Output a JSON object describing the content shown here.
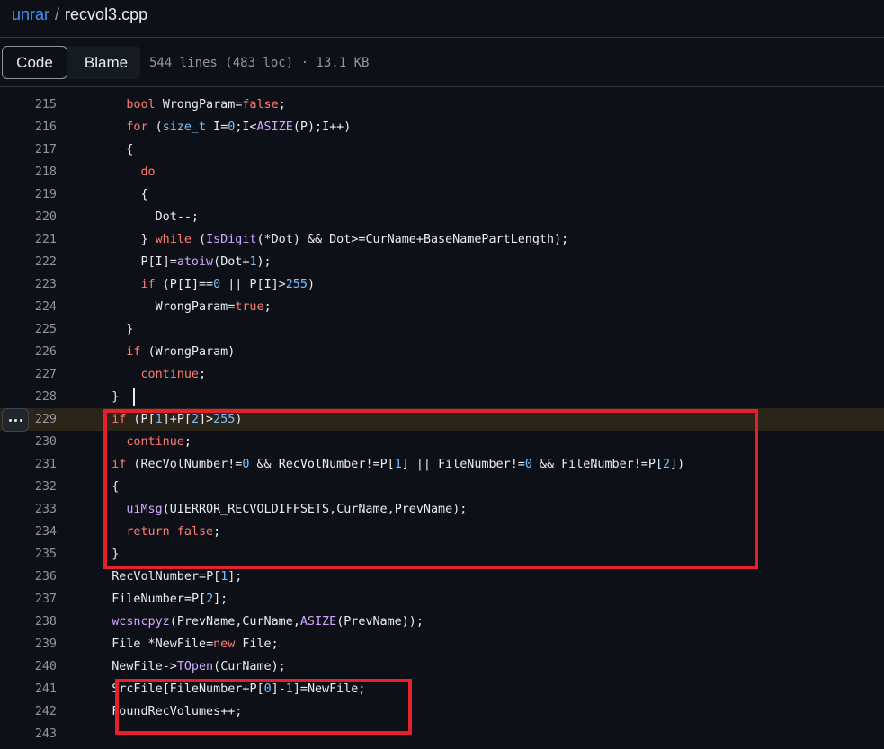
{
  "breadcrumb": {
    "repo": "unrar",
    "separator": "/",
    "file": "recvol3.cpp"
  },
  "toolbar": {
    "code_label": "Code",
    "blame_label": "Blame",
    "meta": "544 lines (483 loc) · 13.1 KB"
  },
  "colors": {
    "background": "#0d1117",
    "keyword": "#ff7b72",
    "function": "#d2a8ff",
    "constant": "#79c0ff",
    "annotation_box": "#e5202d",
    "highlight_line": "#2b2419"
  },
  "icons": {
    "more_button": "kebab-horizontal-icon"
  },
  "lines": [
    {
      "n": "215",
      "text": "      bool WrongParam=false;"
    },
    {
      "n": "216",
      "text": "      for (size_t I=0;I<ASIZE(P);I++)"
    },
    {
      "n": "217",
      "text": "      {"
    },
    {
      "n": "218",
      "text": "        do"
    },
    {
      "n": "219",
      "text": "        {"
    },
    {
      "n": "220",
      "text": "          Dot--;"
    },
    {
      "n": "221",
      "text": "        } while (IsDigit(*Dot) && Dot>=CurName+BaseNamePartLength);"
    },
    {
      "n": "222",
      "text": "        P[I]=atoiw(Dot+1);"
    },
    {
      "n": "223",
      "text": "        if (P[I]==0 || P[I]>255)"
    },
    {
      "n": "224",
      "text": "          WrongParam=true;"
    },
    {
      "n": "225",
      "text": "      }"
    },
    {
      "n": "226",
      "text": "      if (WrongParam)"
    },
    {
      "n": "227",
      "text": "        continue;"
    },
    {
      "n": "228",
      "text": "    }"
    },
    {
      "n": "229",
      "text": "    if (P[1]+P[2]>255)"
    },
    {
      "n": "230",
      "text": "      continue;"
    },
    {
      "n": "231",
      "text": "    if (RecVolNumber!=0 && RecVolNumber!=P[1] || FileNumber!=0 && FileNumber!=P[2])"
    },
    {
      "n": "232",
      "text": "    {"
    },
    {
      "n": "233",
      "text": "      uiMsg(UIERROR_RECVOLDIFFSETS,CurName,PrevName);"
    },
    {
      "n": "234",
      "text": "      return false;"
    },
    {
      "n": "235",
      "text": "    }"
    },
    {
      "n": "236",
      "text": "    RecVolNumber=P[1];"
    },
    {
      "n": "237",
      "text": "    FileNumber=P[2];"
    },
    {
      "n": "238",
      "text": "    wcsncpyz(PrevName,CurName,ASIZE(PrevName));"
    },
    {
      "n": "239",
      "text": "    File *NewFile=new File;"
    },
    {
      "n": "240",
      "text": "    NewFile->TOpen(CurName);"
    },
    {
      "n": "241",
      "text": "    SrcFile[FileNumber+P[0]-1]=NewFile;"
    },
    {
      "n": "242",
      "text": "    FoundRecVolumes++;"
    },
    {
      "n": "243",
      "text": ""
    }
  ]
}
